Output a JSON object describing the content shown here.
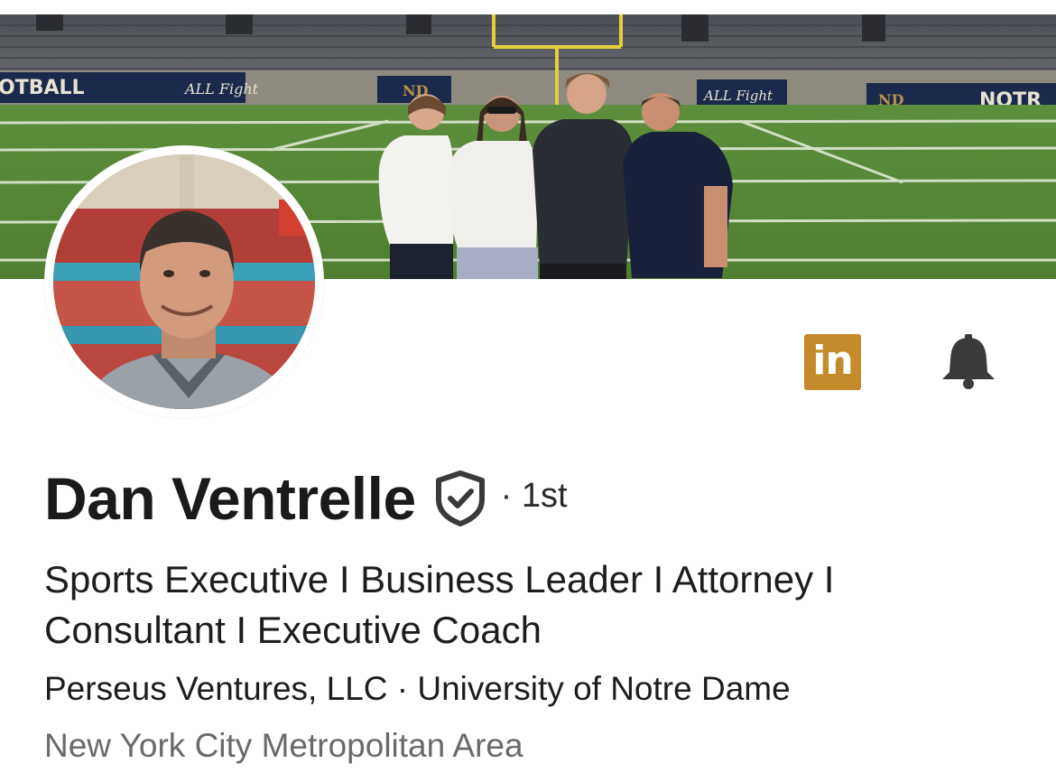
{
  "banner": {
    "sign_left": "OTBALL",
    "sign_allfight_1": "ALL Fight",
    "sign_allfight_2": "ALL Fight",
    "sign_nd": "ND",
    "sign_nd_2": "ND",
    "sign_right": "NOTR"
  },
  "profile": {
    "name": "Dan Ventrelle",
    "connection_degree": "· 1st",
    "headline": "Sports Executive I Business Leader I Attorney I Consultant I Executive Coach",
    "company_school": "Perseus Ventures, LLC · University of Notre Dame",
    "location": "New York City Metropolitan Area"
  },
  "actions": {
    "linkedin_label": "in",
    "linkedin_icon": "linkedin-icon",
    "bell_icon": "bell-icon",
    "verified_icon": "verified-shield-icon"
  },
  "colors": {
    "linkedin_gold": "#c48a2c",
    "bell_dark": "#3a3a3a",
    "text_primary": "#1d1d1d",
    "text_secondary": "#6a6a6a"
  }
}
